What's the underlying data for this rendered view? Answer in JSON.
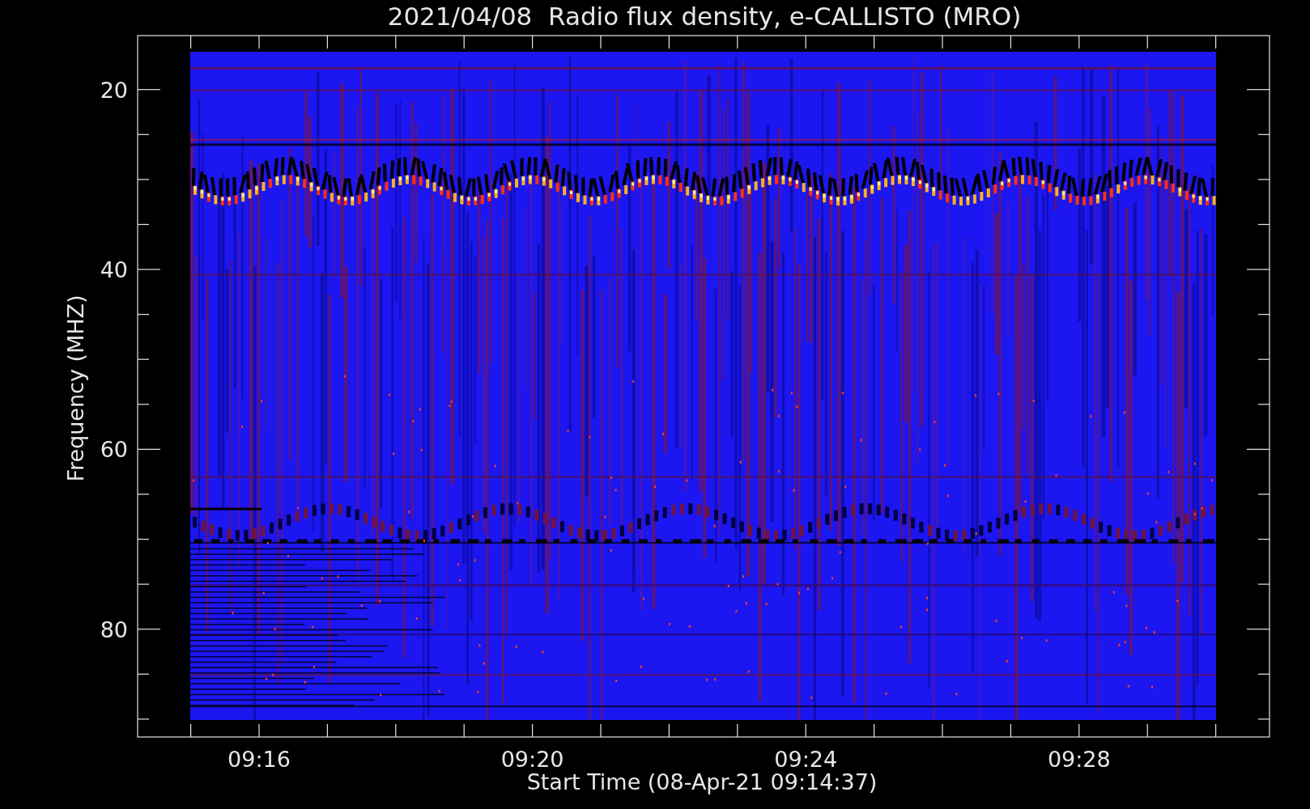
{
  "title": "2021/04/08  Radio flux density, e-CALLISTO (MRO)",
  "y_axis": {
    "label": "Frequency (MHZ)",
    "ticks": [
      "20",
      "40",
      "60",
      "80"
    ]
  },
  "x_axis": {
    "label": "Start Time (08-Apr-21 09:14:37)",
    "ticks": [
      "09:16",
      "09:20",
      "09:24",
      "09:28"
    ]
  }
}
